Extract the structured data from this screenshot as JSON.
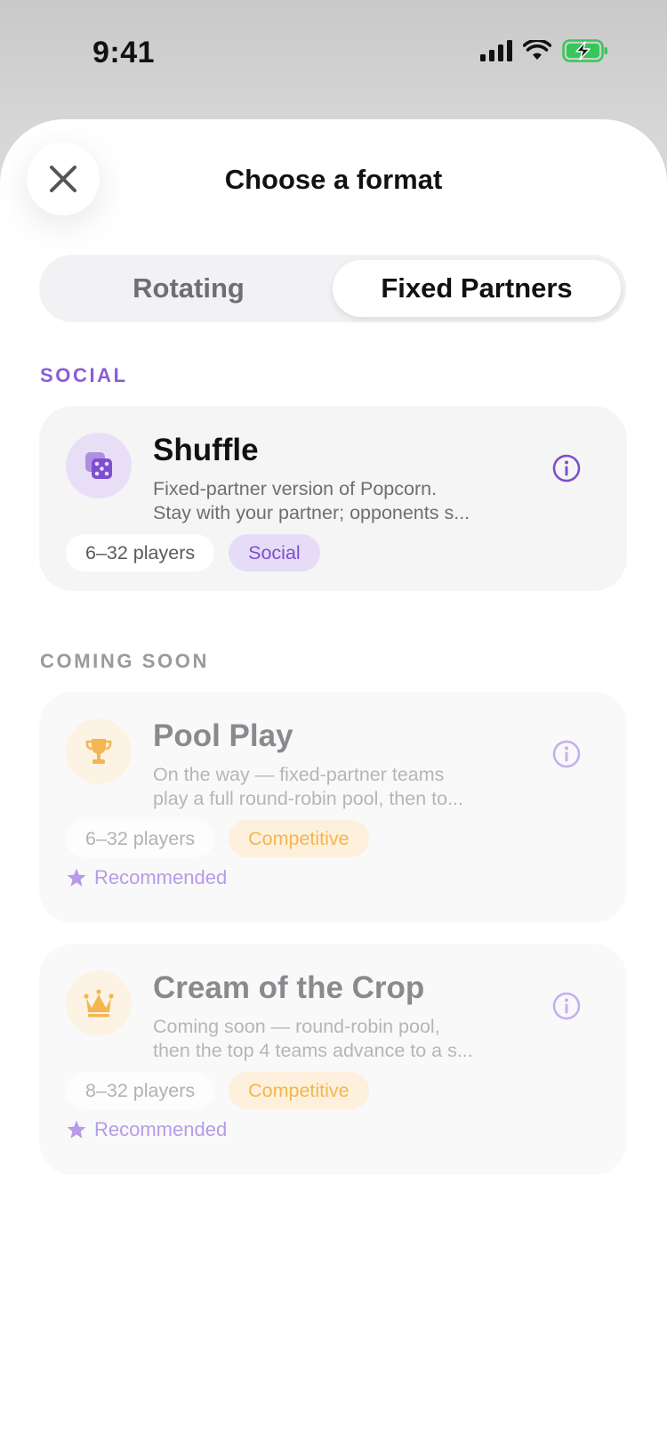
{
  "status_bar": {
    "time": "9:41"
  },
  "header": {
    "title": "Choose a format",
    "close_icon": "close-icon"
  },
  "tabs": [
    {
      "label": "Rotating",
      "active": false
    },
    {
      "label": "Fixed Partners",
      "active": true
    }
  ],
  "sections": {
    "social": {
      "label": "SOCIAL",
      "color": "#8a5cd8"
    },
    "coming_soon": {
      "label": "COMING SOON",
      "color": "#9a9a9e"
    }
  },
  "formats": [
    {
      "title": "Shuffle",
      "desc_line1": "Fixed-partner version of Popcorn.",
      "desc_line2": "Stay with your partner; opponents s...",
      "players": "6–32 players",
      "tag": "Social",
      "icon": "dice-icon",
      "enabled": true
    },
    {
      "title": "Pool Play",
      "desc_line1": "On the way — fixed-partner teams",
      "desc_line2": "play a full round-robin pool, then to...",
      "players": "6–32 players",
      "tag": "Competitive",
      "recommended": "Recommended",
      "icon": "trophy-icon",
      "enabled": false
    },
    {
      "title": "Cream of the Crop",
      "desc_line1": "Coming soon — round-robin pool,",
      "desc_line2": "then the top 4 teams advance to a s...",
      "players": "8–32 players",
      "tag": "Competitive",
      "recommended": "Recommended",
      "icon": "crown-icon",
      "enabled": false
    }
  ],
  "colors": {
    "accent": "#7d4fd0",
    "competitive": "#f4b650",
    "battery": "#35c759"
  }
}
